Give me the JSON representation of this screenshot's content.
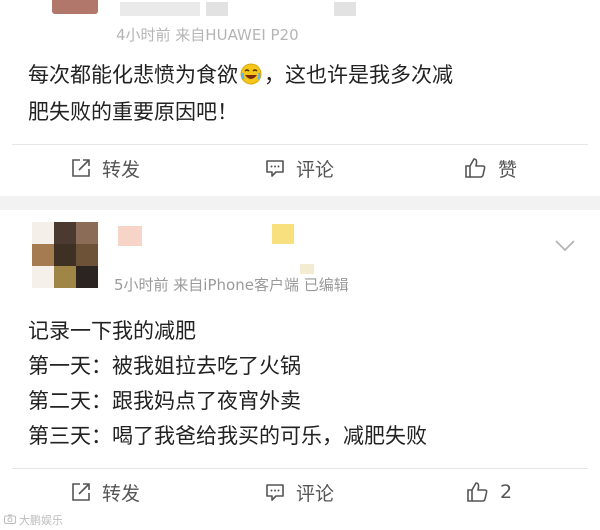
{
  "post1": {
    "meta": "4小时前  来自HUAWEI P20",
    "lines": [
      "每次都能化悲愤为食欲",
      "，这也许是我多次减",
      "肥失败的重要原因吧！"
    ],
    "emoji": "laughing-face-emoji",
    "actions": {
      "repost": "转发",
      "comment": "评论",
      "like": "赞"
    }
  },
  "post2": {
    "meta": "5小时前  来自iPhone客户端  已编辑",
    "lines": [
      "记录一下我的减肥",
      "第一天：被我姐拉去吃了火锅",
      "第二天：跟我妈点了夜宵外卖",
      "第三天：喝了我爸给我买的可乐，减肥失败"
    ],
    "actions": {
      "repost": "转发",
      "comment": "评论",
      "like_count": "2"
    }
  },
  "watermark": "大鹏娱乐",
  "colors": {
    "text": "#222222",
    "meta": "#9a9a9a",
    "action": "#555555",
    "band": "#f2f2f2",
    "emoji": "#f5c518"
  }
}
